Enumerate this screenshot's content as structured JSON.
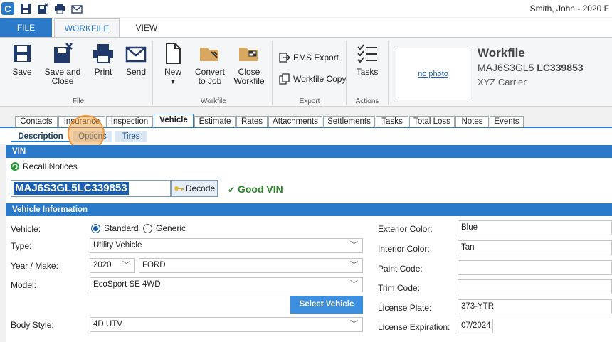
{
  "window": {
    "user_title": "Smith, John - 2020 F"
  },
  "ribbon_tabs": {
    "file": "FILE",
    "workfile": "WORKFILE",
    "view": "VIEW"
  },
  "ribbon": {
    "save": "Save",
    "save_close_1": "Save and",
    "save_close_2": "Close",
    "print": "Print",
    "send": "Send",
    "group_file": "File",
    "new": "New",
    "convert_1": "Convert",
    "convert_2": "to Job",
    "close_wf_1": "Close",
    "close_wf_2": "Workfile",
    "group_workfile": "Workfile",
    "ems_export": "EMS Export",
    "workfile_copy": "Workfile Copy",
    "group_export": "Export",
    "tasks": "Tasks",
    "group_actions": "Actions"
  },
  "workfile_info": {
    "photo_link": "no photo",
    "title": "Workfile",
    "vin_prefix": "MAJ6S3GL5",
    "vin_suffix": "LC339853",
    "carrier": "XYZ Carrier"
  },
  "main_tabs": [
    "Contacts",
    "Insurance",
    "Inspection",
    "Vehicle",
    "Estimate",
    "Rates",
    "Attachments",
    "Settlements",
    "Tasks",
    "Total Loss",
    "Notes",
    "Events"
  ],
  "sub_tabs": [
    "Description",
    "Options",
    "Tires"
  ],
  "vin_section": {
    "header": "VIN",
    "recall": "Recall Notices",
    "vin_value": "MAJ6S3GL5LC339853",
    "decode": "Decode",
    "status": "Good VIN"
  },
  "vehicle_info": {
    "header": "Vehicle Information",
    "vehicle_label": "Vehicle:",
    "standard": "Standard",
    "generic": "Generic",
    "type_label": "Type:",
    "type_value": "Utility Vehicle",
    "year_make_label": "Year / Make:",
    "year_value": "2020",
    "make_value": "FORD",
    "model_label": "Model:",
    "model_value": "EcoSport SE 4WD",
    "select_vehicle": "Select Vehicle",
    "body_label": "Body Style:",
    "body_value": "4D UTV",
    "ext_color_label": "Exterior Color:",
    "ext_color_value": "Blue",
    "int_color_label": "Interior Color:",
    "int_color_value": "Tan",
    "paint_label": "Paint Code:",
    "paint_value": "",
    "trim_label": "Trim Code:",
    "trim_value": "",
    "plate_label": "License Plate:",
    "plate_value": "373-YTR",
    "expiration_label": "License Expiration:",
    "expiration_value": "07/2024"
  },
  "colors": {
    "accent": "#2b79c9",
    "good": "#2a8a2a",
    "highlight": "#f59628"
  }
}
